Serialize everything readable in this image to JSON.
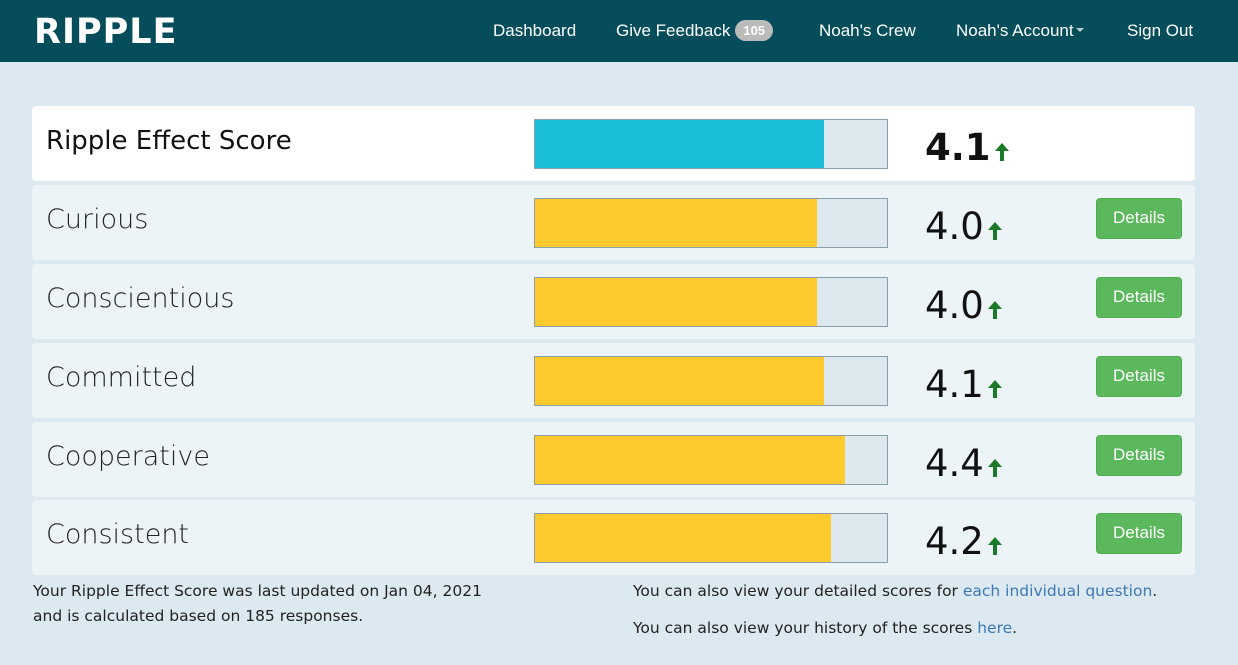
{
  "brand": {
    "logo_text": "RIPPLE"
  },
  "nav": {
    "dashboard": "Dashboard",
    "give_feedback": "Give Feedback",
    "feedback_count": "105",
    "crew": "Noah's Crew",
    "account": "Noah's Account",
    "sign_out": "Sign Out"
  },
  "rows": [
    {
      "label": "Ripple Effect Score",
      "score": "4.1",
      "fill_fraction": 0.82,
      "trend": "up",
      "fill_color": "#1abed8"
    },
    {
      "label": "Curious",
      "score": "4.0",
      "fill_fraction": 0.8,
      "trend": "up",
      "fill_color": "#ffca2e",
      "details_label": "Details"
    },
    {
      "label": "Conscientious",
      "score": "4.0",
      "fill_fraction": 0.8,
      "trend": "up",
      "fill_color": "#ffca2e",
      "details_label": "Details"
    },
    {
      "label": "Committed",
      "score": "4.1",
      "fill_fraction": 0.82,
      "trend": "up",
      "fill_color": "#ffca2e",
      "details_label": "Details"
    },
    {
      "label": "Cooperative",
      "score": "4.4",
      "fill_fraction": 0.88,
      "trend": "up",
      "fill_color": "#ffca2e",
      "details_label": "Details"
    },
    {
      "label": "Consistent",
      "score": "4.2",
      "fill_fraction": 0.84,
      "trend": "up",
      "fill_color": "#ffca2e",
      "details_label": "Details"
    }
  ],
  "footer": {
    "update_line1": "Your Ripple Effect Score was last updated on Jan 04, 2021",
    "update_line2": "and is calculated based on 185 responses.",
    "detail_prefix": "You can also view your detailed scores for ",
    "detail_link": "each individual question",
    "detail_suffix": ".",
    "history_prefix": "You can also view your history of the scores ",
    "history_link": "here",
    "history_suffix": "."
  },
  "colors": {
    "navbar": "#054d5a",
    "background": "#dde9f0",
    "trend_up": "#1b7a2a",
    "details_button": "#5cb85c",
    "link": "#3c78b4"
  }
}
